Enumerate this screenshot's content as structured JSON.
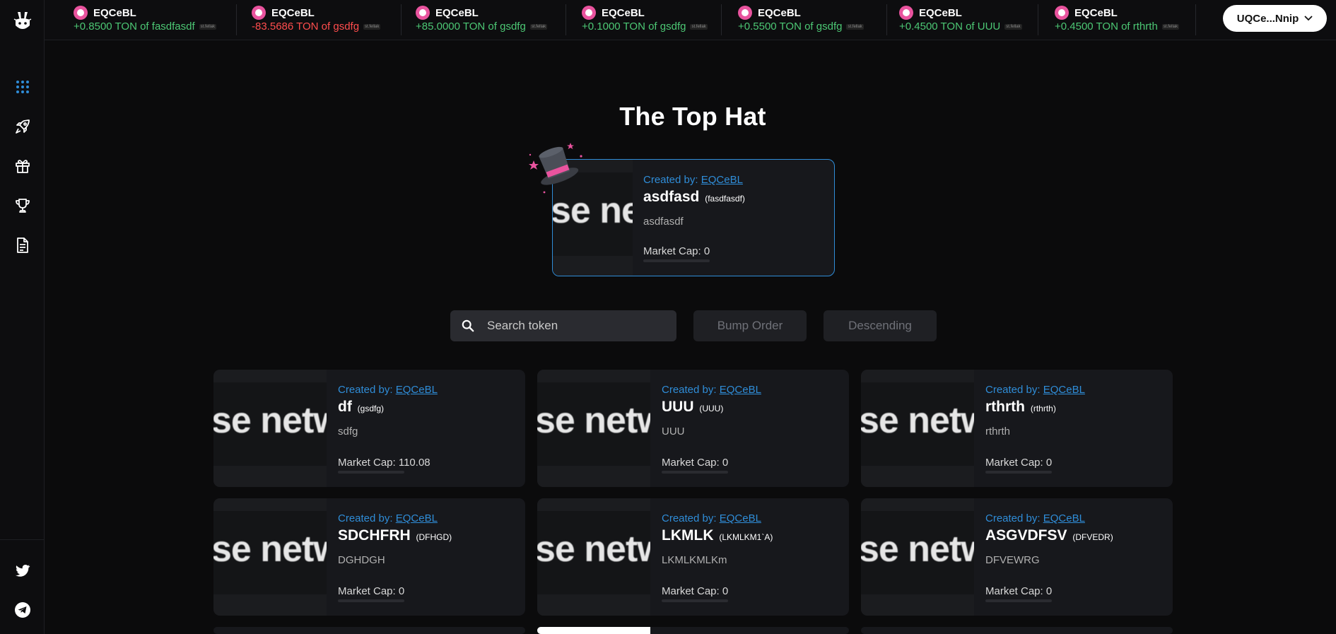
{
  "wallet": {
    "label": "UQCe...Nnip"
  },
  "ticker": [
    {
      "creator": "EQCeBL",
      "amount": "+0.8500 TON of fasdfasdf",
      "dir": "pos",
      "src": "st.fellak"
    },
    {
      "creator": "EQCeBL",
      "amount": "-83.5686 TON of gsdfg",
      "dir": "neg",
      "src": "st.fellak"
    },
    {
      "creator": "EQCeBL",
      "amount": "+85.0000 TON of gsdfg",
      "dir": "pos",
      "src": "st.fellak"
    },
    {
      "creator": "EQCeBL",
      "amount": "+0.1000 TON of gsdfg",
      "dir": "pos",
      "src": "st.fellak"
    },
    {
      "creator": "EQCeBL",
      "amount": "+0.5500 TON of gsdfg",
      "dir": "pos",
      "src": "st.fellak"
    },
    {
      "creator": "EQCeBL",
      "amount": "+0.4500 TON of UUU",
      "dir": "pos",
      "src": "st.fellak"
    },
    {
      "creator": "EQCeBL",
      "amount": "+0.4500 TON of rthrth",
      "dir": "pos",
      "src": "st.fellak"
    }
  ],
  "page": {
    "title": "The Top Hat"
  },
  "top_hat": {
    "created_by_label": "Created by:",
    "creator": "EQCeBL",
    "name": "asdfasd",
    "symbol": "(fasdfasdf)",
    "description": "asdfasdf",
    "market_cap": "Market Cap: 0"
  },
  "image_text": "se netwo",
  "controls": {
    "search_placeholder": "Search token",
    "sort_label": "Bump Order",
    "order_label": "Descending"
  },
  "tokens": [
    {
      "created_by_label": "Created by:",
      "creator": "EQCeBL",
      "name": "df",
      "symbol": "(gsdfg)",
      "description": "sdfg",
      "market_cap": "Market Cap: 110.08"
    },
    {
      "created_by_label": "Created by:",
      "creator": "EQCeBL",
      "name": "UUU",
      "symbol": "(UUU)",
      "description": "UUU",
      "market_cap": "Market Cap: 0"
    },
    {
      "created_by_label": "Created by:",
      "creator": "EQCeBL",
      "name": "rthrth",
      "symbol": "(rthrth)",
      "description": "rthrth",
      "market_cap": "Market Cap: 0"
    },
    {
      "created_by_label": "Created by:",
      "creator": "EQCeBL",
      "name": "SDCHFRH",
      "symbol": "(DFHGD)",
      "description": "DGHDGH",
      "market_cap": "Market Cap: 0"
    },
    {
      "created_by_label": "Created by:",
      "creator": "EQCeBL",
      "name": "LKMLK",
      "symbol": "(LKMLKM1`A)",
      "description": "LKMLKMLKm",
      "market_cap": "Market Cap: 0"
    },
    {
      "created_by_label": "Created by:",
      "creator": "EQCeBL",
      "name": "ASGVDFSV",
      "symbol": "(DFVEDR)",
      "description": "DFVEWRG",
      "market_cap": "Market Cap: 0"
    }
  ],
  "colors": {
    "accent": "#2f8dd8",
    "positive": "#4cc774",
    "negative": "#ff4d4d",
    "avatar": "#e9539e"
  },
  "icons": {
    "sidebar": [
      "grid-icon",
      "rocket-icon",
      "gift-icon",
      "trophy-icon",
      "document-icon",
      "twitter-icon",
      "telegram-icon"
    ]
  }
}
